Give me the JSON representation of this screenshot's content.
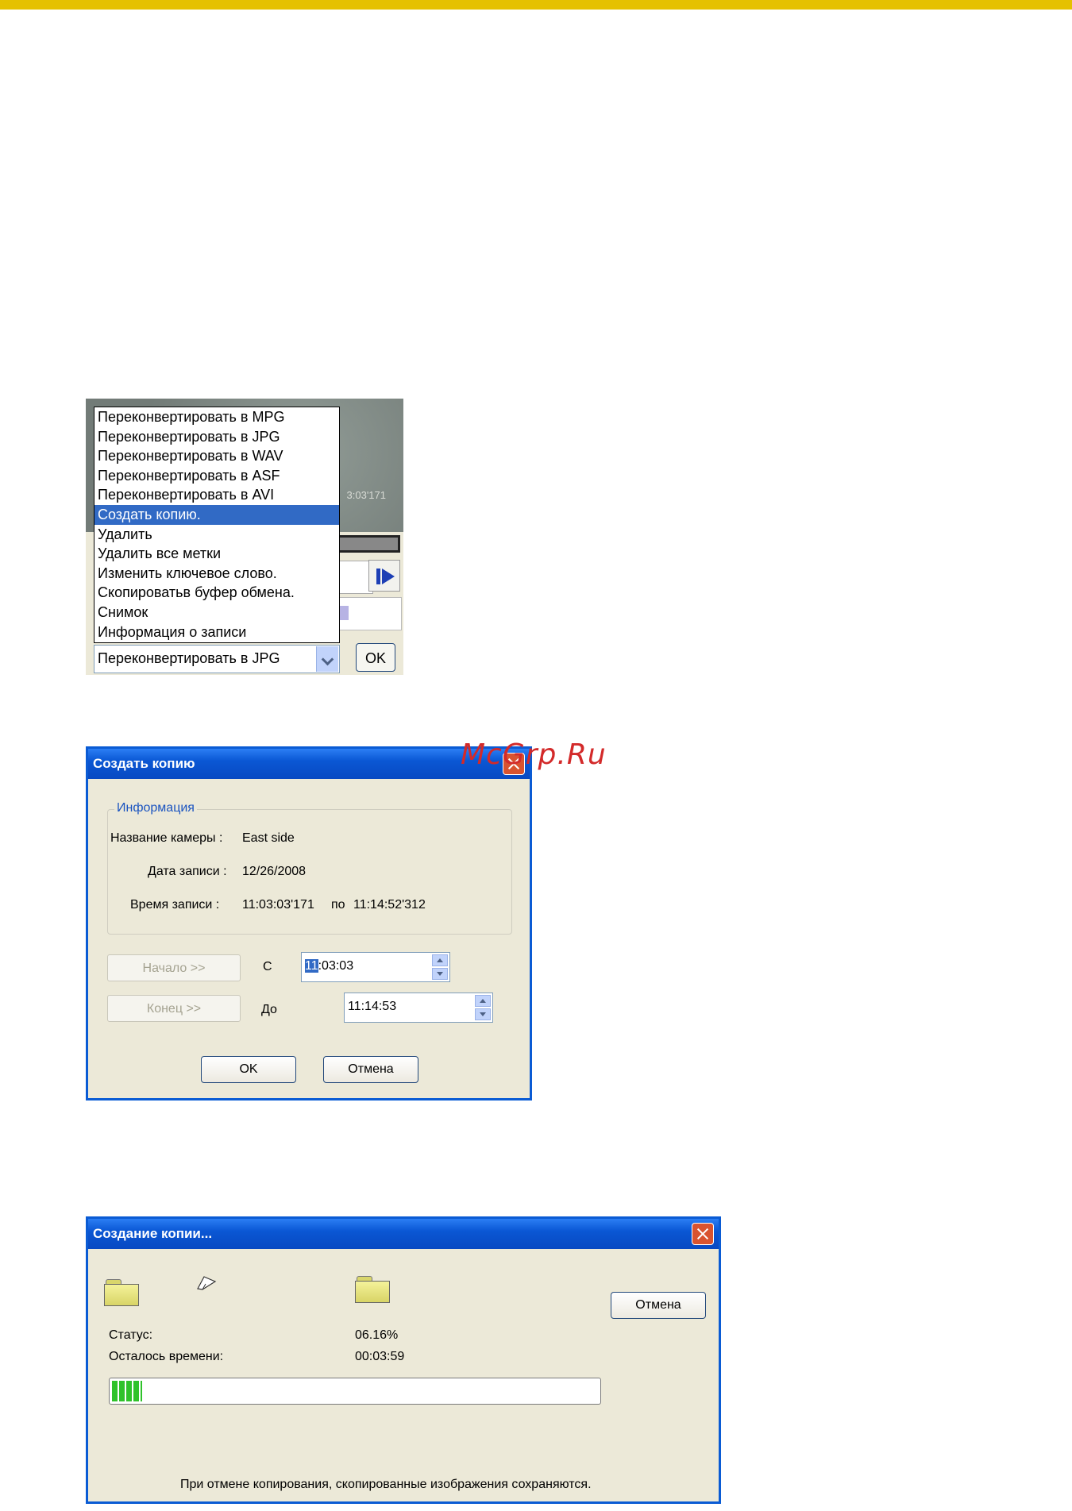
{
  "menu": {
    "items": [
      "Переконвертировать в MPG",
      "Переконвертировать в JPG",
      "Переконвертировать в WAV",
      "Переконвертировать в ASF",
      "Переконвертировать в AVI",
      "Создать копию.",
      "Удалить",
      "Удалить все метки",
      "Изменить ключевое слово.",
      "Скопироватьв буфер обмена.",
      "Снимок",
      "Информация о записи"
    ],
    "selected_index": 5,
    "video_timestamp": "3:03'171",
    "combo_value": "Переконвертировать в JPG",
    "ok_label": "OK"
  },
  "copy_dialog": {
    "title": "Создать копию",
    "group_title": "Информация",
    "camera_label": "Название камеры :",
    "camera_value": "East side",
    "date_label": "Дата записи :",
    "date_value": "12/26/2008",
    "time_label": "Время записи :",
    "time_from": "11:03:03'171",
    "time_to_prefix": "по",
    "time_to": "11:14:52'312",
    "start_button": "Начало >>",
    "from_label": "С",
    "start_value_sel": "11",
    "start_value_rest": ":03:03",
    "end_button": "Конец >>",
    "to_label": "До",
    "end_value": "11:14:53",
    "ok_label": "OK",
    "cancel_label": "Отмена"
  },
  "watermark": "McGrp.Ru",
  "progress_dialog": {
    "title": "Создание копии...",
    "cancel_label": "Отмена",
    "status_label": "Статус:",
    "status_value": "06.16%",
    "remaining_label": "Осталось времени:",
    "remaining_value": "00:03:59",
    "progress_percent": 6.16,
    "note": "При отмене копирования, скопированные изображения сохраняются."
  },
  "colors": {
    "accent_top": "#e5c100",
    "title_blue": "#0a57d4",
    "selection": "#316ac5",
    "progress_green": "#2fc22a",
    "watermark_red": "#d32a2a"
  }
}
